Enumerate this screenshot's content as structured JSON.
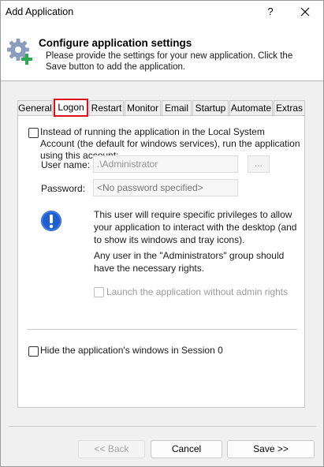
{
  "window": {
    "title": "Add Application",
    "help_label": "?",
    "close_icon": "close-icon"
  },
  "header": {
    "icon": "gear-plus-icon",
    "title": "Configure application settings",
    "description": "Please provide the settings for your new application. Click the Save button to add the application."
  },
  "tabs": [
    {
      "label": "General",
      "active": false
    },
    {
      "label": "Logon",
      "active": true
    },
    {
      "label": "Restart",
      "active": false
    },
    {
      "label": "Monitor",
      "active": false
    },
    {
      "label": "Email",
      "active": false
    },
    {
      "label": "Startup",
      "active": false
    },
    {
      "label": "Automate",
      "active": false
    },
    {
      "label": "Extras",
      "active": false
    }
  ],
  "logon": {
    "run_as_account_label": "Instead of running the application in the Local System Account (the default for windows services), run the application using this account:",
    "run_as_account_checked": false,
    "username_label": "User name:",
    "username_value": ".\\Administrator",
    "browse_label": "...",
    "password_label": "Password:",
    "password_placeholder": "<No password specified>",
    "info_icon": "exclamation-info-icon",
    "info_text_1": "This user will require specific privileges to allow your application to interact with the desktop (and to show its windows and tray icons).",
    "info_text_2": "Any user in the \"Administrators\" group should have the necessary rights.",
    "launch_without_admin_label": "Launch the application without admin rights",
    "launch_without_admin_checked": false,
    "hide_windows_label": "Hide the application's windows in Session 0",
    "hide_windows_checked": false
  },
  "footer": {
    "back_label": "<< Back",
    "cancel_label": "Cancel",
    "save_label": "Save >>"
  },
  "colors": {
    "active_tab_highlight": "#e0101a",
    "info_icon": "#1f5fcf",
    "gear_icon": "#7b8fb0",
    "plus_icon": "#2fa84f"
  }
}
